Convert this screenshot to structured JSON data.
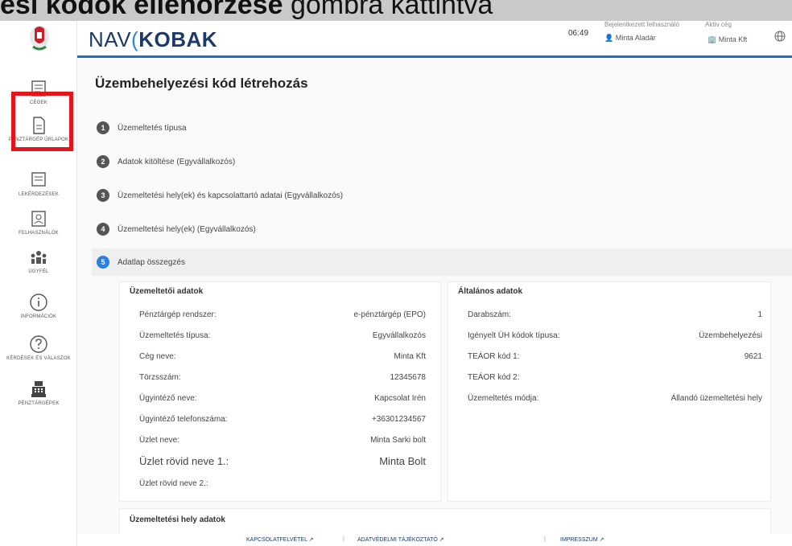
{
  "caption": {
    "part1": "ési kódok ellenőrzése",
    "part2": " gombra kattintva"
  },
  "brand": {
    "nav": "NAV",
    "kobak": "KOBAK"
  },
  "topbar": {
    "time": "06:49",
    "user_caption": "Bejelentkezett felhasználó",
    "user_name": "Minta Aladár",
    "company_caption": "Aktív cég",
    "company_name": "Minta Kft"
  },
  "sidebar": {
    "items": [
      {
        "label": "CÉGEK",
        "icon": "list-icon"
      },
      {
        "label": "PÉNZTÁRGÉP ŰRLAPOK",
        "icon": "document-icon"
      },
      {
        "label": "LEKÉRDEZÉSEK",
        "icon": "list-icon"
      },
      {
        "label": "FELHASZNÁLÓK",
        "icon": "user-card-icon"
      },
      {
        "label": "ÜGYFÉL",
        "icon": "people-icon"
      },
      {
        "label": "INFORMÁCIÓK",
        "icon": "info-icon"
      },
      {
        "label": "KÉRDÉSEK ÉS VÁLASZOK",
        "icon": "question-icon"
      },
      {
        "label": "PÉNZTÁRGÉPEK",
        "icon": "cash-register-icon"
      }
    ]
  },
  "page": {
    "title": "Üzembehelyezési kód létrehozás"
  },
  "steps": [
    {
      "num": "1",
      "label": "Üzemeltetés típusa"
    },
    {
      "num": "2",
      "label": "Adatok kitöltése (Egyvállalkozós)"
    },
    {
      "num": "3",
      "label": "Üzemeltetési hely(ek) és kapcsolattartó adatai (Egyvállalkozós)"
    },
    {
      "num": "4",
      "label": "Üzemeltetési hely(ek) (Egyvállalkozós)"
    },
    {
      "num": "5",
      "label": "Adatlap összegzés"
    }
  ],
  "operator": {
    "title": "Üzemeltetői adatok",
    "rows": [
      {
        "label": "Pénztárgép rendszer:",
        "value": "e-pénztárgép (EPO)"
      },
      {
        "label": "Üzemeltetés típusa:",
        "value": "Egyvállalkozós"
      },
      {
        "label": "Cég neve:",
        "value": "Minta Kft"
      },
      {
        "label": "Törzsszám:",
        "value": "12345678"
      },
      {
        "label": "Ügyintéző neve:",
        "value": "Kapcsolat Irén"
      },
      {
        "label": "Ügyintéző telefonszáma:",
        "value": "+36301234567"
      },
      {
        "label": "Üzlet neve:",
        "value": "Minta Sarki bolt"
      },
      {
        "label": "Üzlet rövid neve 1.:",
        "value": "Minta Bolt"
      },
      {
        "label": "Üzlet rövid neve 2.:",
        "value": ""
      }
    ]
  },
  "general": {
    "title": "Általános adatok",
    "rows": [
      {
        "label": "Darabszám:",
        "value": "1"
      },
      {
        "label": "Igényelt ÜH kódok típusa:",
        "value": "Üzembehelyezési"
      },
      {
        "label": "TEÁOR kód 1:",
        "value": "9621"
      },
      {
        "label": "TEÁOR kód 2:",
        "value": ""
      },
      {
        "label": "Üzemeltetés módja:",
        "value": "Állandó üzemeltetési hely"
      }
    ]
  },
  "location": {
    "title": "Üzemeltetési hely adatok"
  },
  "footer": {
    "link1": "KAPCSOLATFELVÉTEL ↗",
    "link2": "ADATVÉDELMI TÁJÉKOZTATÓ ↗",
    "link3": "IMPRESSZUM ↗"
  },
  "colors": {
    "accent": "#1f6fc4",
    "highlight": "#e3151a",
    "step_active": "#2a7fe0"
  }
}
